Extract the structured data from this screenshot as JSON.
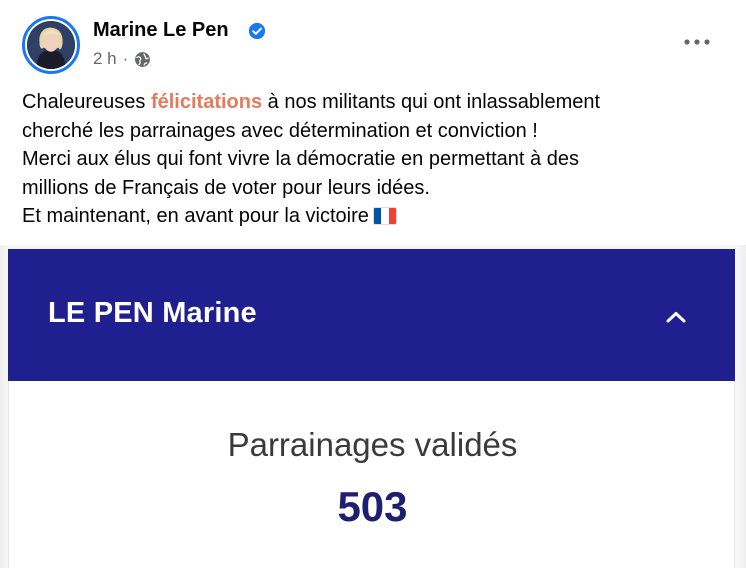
{
  "post": {
    "author": {
      "name": "Marine Le Pen",
      "verified": true,
      "avatar_icon": "profile-photo"
    },
    "meta": {
      "time": "2 h",
      "separator": "·",
      "visibility_icon": "globe-icon"
    },
    "text": {
      "line1_before": "Chaleureuses ",
      "line1_highlight": "félicitations",
      "line1_after": " à nos militants qui ont inlassablement",
      "line2": "cherché les parrainages avec détermination et conviction !",
      "line3": "Merci aux élus qui font vivre la démocratie en permettant à des",
      "line4": "millions de Français de voter pour leurs idées.",
      "line5": "Et maintenant, en avant pour la victoire",
      "flag_icon": "france-flag-icon"
    },
    "colors": {
      "highlight": "#e57a5c",
      "verified": "#1877f2",
      "banner": "#1f1f8f",
      "count": "#1f1f6f"
    }
  },
  "embedded": {
    "candidate_name": "LE PEN Marine",
    "collapse_icon": "chevron-up-icon",
    "label": "Parrainages validés",
    "value": "503"
  }
}
